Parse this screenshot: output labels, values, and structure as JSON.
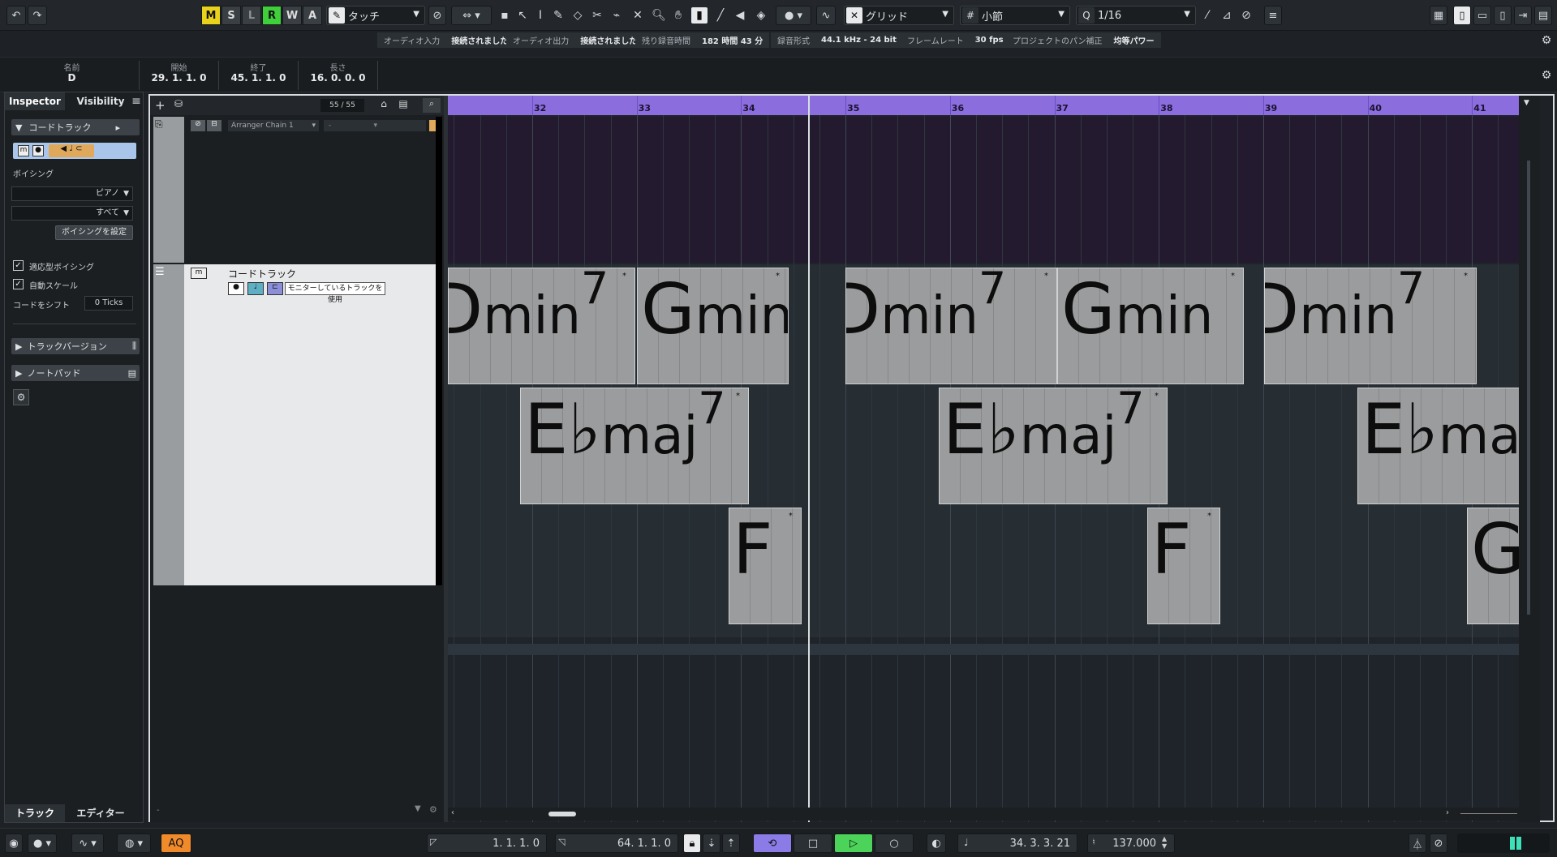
{
  "toolbar": {
    "ms_buttons": [
      "M",
      "S",
      "L",
      "R",
      "W",
      "A"
    ],
    "automation_mode": "タッチ",
    "snap_type": "グリッド",
    "grid_type": "小節",
    "quantize": "1/16"
  },
  "status": {
    "audio_in_label": "オーディオ入力",
    "audio_in_value": "接続されました",
    "audio_out_label": "オーディオ出力",
    "audio_out_value": "接続されました",
    "rec_time_label": "残り録音時間",
    "rec_time_value": "182 時間 43 分",
    "rec_format_label": "録音形式",
    "rec_format_value": "44.1 kHz - 24 bit",
    "frame_rate_label": "フレームレート",
    "frame_rate_value": "30 fps",
    "pan_label": "プロジェクトのパン補正",
    "pan_value": "均等パワー"
  },
  "infoline": {
    "name_label": "名前",
    "name_value": "D",
    "start_label": "開始",
    "start_value": "29. 1. 1.   0",
    "end_label": "終了",
    "end_value": "45. 1. 1.   0",
    "length_label": "長さ",
    "length_value": "16. 0. 0.   0"
  },
  "inspector": {
    "tab_inspector": "Inspector",
    "tab_visibility": "Visibility",
    "track_section": "コードトラック",
    "voicing_label": "ボイシング",
    "voicing_instrument": "ピアノ",
    "voicing_all": "すべて",
    "voicing_set_button": "ボイシングを設定",
    "adaptive_voicing": "適応型ボイシング",
    "auto_scale": "自動スケール",
    "chord_shift_label": "コードをシフト",
    "chord_shift_value": "0 Ticks",
    "track_version": "トラックバージョン",
    "notepad": "ノートパッド"
  },
  "tracklist": {
    "count": "55 / 55",
    "arranger_chain": "Arranger Chain 1",
    "arranger_second": "-",
    "chord_track_name": "コードトラック",
    "monitor_label": "モニターしているトラックを使用"
  },
  "ruler": {
    "bars": [
      "32",
      "33",
      "34",
      "35",
      "36",
      "37",
      "38",
      "39",
      "40",
      "41"
    ]
  },
  "chords": [
    {
      "root": "D",
      "quality": "min",
      "ext": "7"
    },
    {
      "root": "G",
      "quality": "min",
      "ext": ""
    },
    {
      "root": "D",
      "quality": "min",
      "ext": "7"
    },
    {
      "root": "G",
      "quality": "min",
      "ext": ""
    },
    {
      "root": "D",
      "quality": "min",
      "ext": "7"
    },
    {
      "root": "E♭",
      "quality": "maj",
      "ext": "7"
    },
    {
      "root": "E♭",
      "quality": "maj",
      "ext": "7"
    },
    {
      "root": "E♭",
      "quality": "maj",
      "ext": ""
    },
    {
      "root": "F",
      "quality": "",
      "ext": ""
    },
    {
      "root": "F",
      "quality": "",
      "ext": ""
    },
    {
      "root": "G",
      "quality": "",
      "ext": ""
    }
  ],
  "bottom_tabs": {
    "track": "トラック",
    "editor": "エディター"
  },
  "transport": {
    "aq": "AQ",
    "left_locator": "1. 1. 1.   0",
    "right_locator": "64. 1. 1.   0",
    "position": "34. 3. 3. 21",
    "tempo": "137.000"
  }
}
